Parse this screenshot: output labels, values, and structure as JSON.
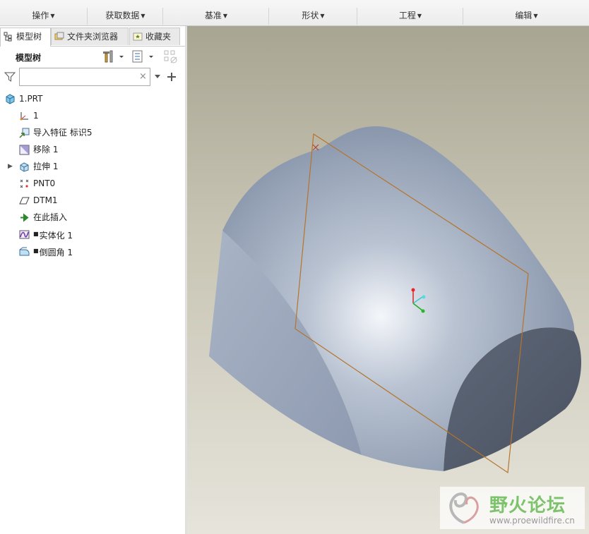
{
  "ribbon": {
    "groups": [
      "操作",
      "获取数据",
      "基准",
      "形状",
      "工程",
      "编辑"
    ]
  },
  "panel": {
    "tabs": [
      {
        "label": "模型树",
        "active": true
      },
      {
        "label": "文件夹浏览器",
        "active": false
      },
      {
        "label": "收藏夹",
        "active": false
      }
    ],
    "tree_title": "模型树",
    "filter_placeholder": "",
    "filter_clear": "×"
  },
  "tree": {
    "root": "1.PRT",
    "items": [
      {
        "label": "1",
        "icon": "coordinate-system-icon"
      },
      {
        "label": "导入特征 标识5",
        "icon": "import-feature-icon"
      },
      {
        "label": "移除 1",
        "icon": "remove-icon"
      },
      {
        "label": "拉伸 1",
        "icon": "extrude-icon",
        "expandable": true
      },
      {
        "label": "PNT0",
        "icon": "datum-point-icon"
      },
      {
        "label": "DTM1",
        "icon": "datum-plane-icon"
      },
      {
        "label": "在此插入",
        "icon": "insert-here-arrow-icon"
      },
      {
        "label": "实体化 1",
        "icon": "solidify-icon",
        "locked": true
      },
      {
        "label": "倒圆角 1",
        "icon": "round-icon",
        "locked": true
      }
    ]
  },
  "watermark": {
    "title": "野火论坛",
    "url": "www.proewildfire.cn"
  },
  "colors": {
    "accent_green": "#7cc36b",
    "datum_plane": "#b5742a",
    "model": "#9aa6b8"
  }
}
